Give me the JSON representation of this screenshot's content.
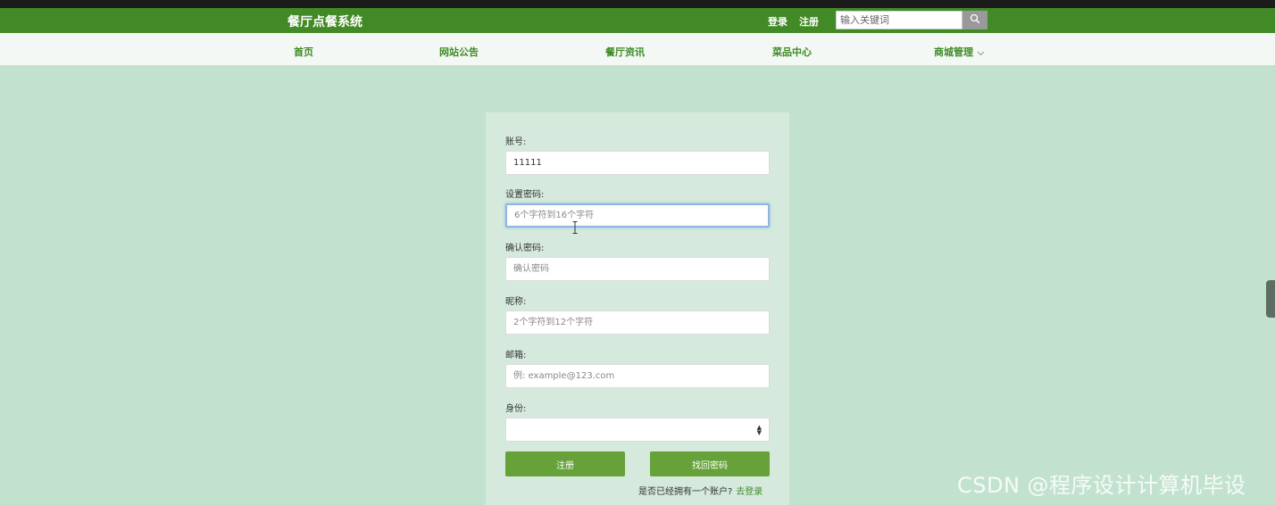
{
  "header": {
    "brand": "餐厅点餐系统",
    "login_label": "登录",
    "register_label": "注册",
    "search_placeholder": "输入关键词",
    "search_icon": "search-icon",
    "bg_color": "#418a25"
  },
  "nav": {
    "items": [
      {
        "label": "首页"
      },
      {
        "label": "网站公告"
      },
      {
        "label": "餐厅资讯"
      },
      {
        "label": "菜品中心"
      },
      {
        "label": "商城管理",
        "icon": "chevron-down-icon"
      }
    ]
  },
  "form": {
    "account": {
      "label": "账号:",
      "value": "11111"
    },
    "password": {
      "label": "设置密码:",
      "placeholder": "6个字符到16个字符"
    },
    "confirm_password": {
      "label": "确认密码:",
      "placeholder": "确认密码"
    },
    "nickname": {
      "label": "昵称:",
      "placeholder": "2个字符到12个字符"
    },
    "email": {
      "label": "邮箱:",
      "placeholder": "例: example@123.com"
    },
    "identity": {
      "label": "身份:",
      "value": ""
    },
    "register_button": "注册",
    "recover_button": "找回密码",
    "have_account_text": "是否已经拥有一个账户?",
    "go_login_link": "去登录",
    "accent_color": "#66a139"
  },
  "watermark": "CSDN @程序设计计算机毕设"
}
